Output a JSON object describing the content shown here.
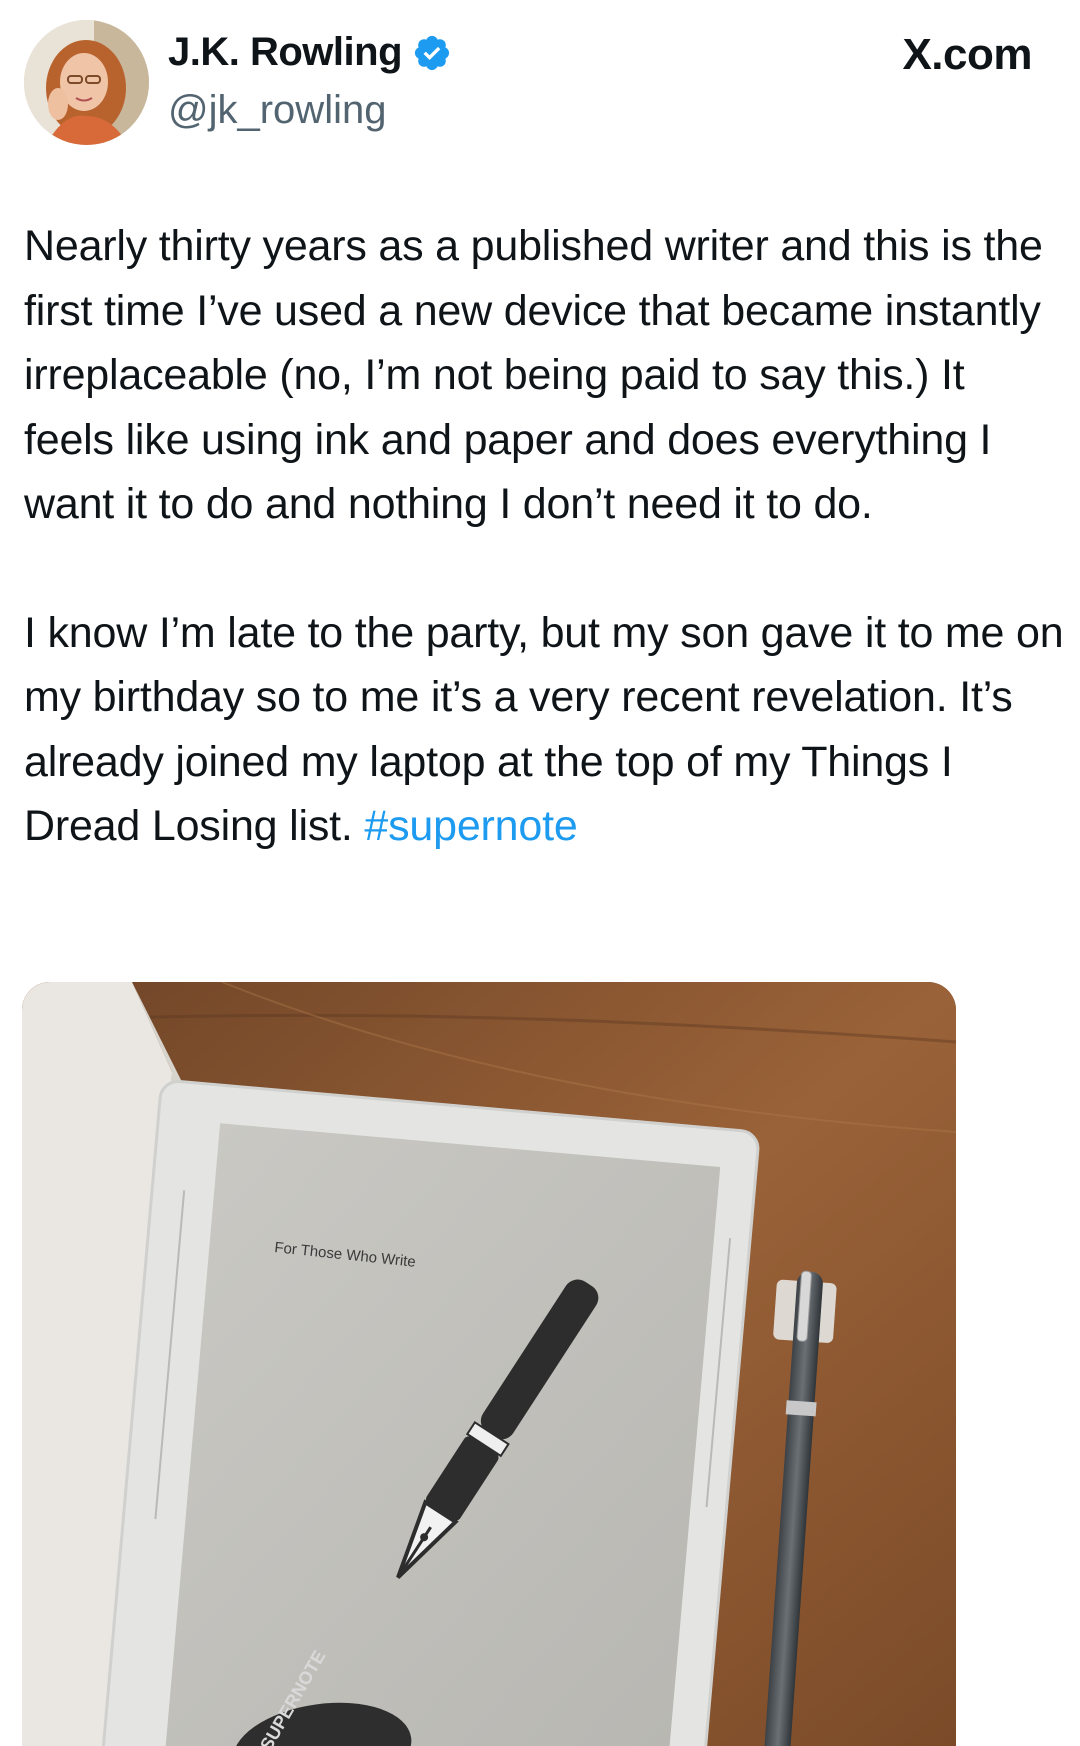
{
  "header": {
    "display_name": "J.K. Rowling",
    "handle": "@jk_rowling",
    "site": "X.com",
    "verified_icon": "verified-badge-icon",
    "verified_color": "#1d9bf0"
  },
  "tweet": {
    "paragraph_1": "Nearly thirty years as a published writer and this is the first time I’ve used a new device that became instantly irreplaceable (no, I’m not being paid to say this.) It feels like using ink and paper and does everything I want it to do and nothing I don’t need it to do.",
    "paragraph_2_text": "I know I’m late to the party, but my son gave it to me on my birthday so to me it’s a very recent revelation. It’s already joined my laptop at the top of my Things I Dread Losing list. ",
    "hashtag": "#supernote",
    "hashtag_color": "#1d9bf0"
  },
  "media": {
    "screen_caption": "For Those Who Write",
    "logo_text": "SUPERNOTE",
    "icon": "fountain-pen-icon"
  }
}
